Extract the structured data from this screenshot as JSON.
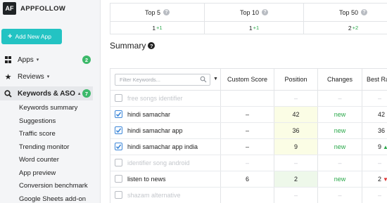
{
  "brand": {
    "logo": "AF",
    "name": "APPFOLLOW"
  },
  "add_button": {
    "label": "Add New App"
  },
  "nav": {
    "apps": {
      "label": "Apps",
      "badge": "2"
    },
    "reviews": {
      "label": "Reviews"
    },
    "keywords": {
      "label": "Keywords & ASO",
      "badge": "7"
    },
    "sub_items": [
      "Keywords summary",
      "Suggestions",
      "Traffic score",
      "Trending monitor",
      "Word counter",
      "App preview",
      "Conversion benchmark",
      "Google Sheets add-on"
    ]
  },
  "top_stats": [
    {
      "label": "Top 5",
      "value": "1",
      "delta": "+1"
    },
    {
      "label": "Top 10",
      "value": "1",
      "delta": "+1"
    },
    {
      "label": "Top 50",
      "value": "2",
      "delta": "+2"
    }
  ],
  "summary": {
    "title": "Summary"
  },
  "table": {
    "filter_placeholder": "Filter Keywords...",
    "columns": {
      "custom_score": "Custom Score",
      "position": "Position",
      "changes": "Changes",
      "best_rank": "Best Ra"
    },
    "rows": [
      {
        "keyword": "free songs identifier",
        "checked": false,
        "muted": true,
        "custom": "",
        "position": "–",
        "change": "–",
        "best": "–",
        "best_arrow": ""
      },
      {
        "keyword": "hindi samachar",
        "checked": true,
        "muted": false,
        "custom": "–",
        "position": "42",
        "change": "new",
        "best": "42",
        "best_arrow": "up"
      },
      {
        "keyword": "hindi samachar app",
        "checked": true,
        "muted": false,
        "custom": "–",
        "position": "36",
        "change": "new",
        "best": "36",
        "best_arrow": "up"
      },
      {
        "keyword": "hindi samachar app india",
        "checked": true,
        "muted": false,
        "custom": "–",
        "position": "9",
        "change": "new",
        "best": "9",
        "best_arrow": "up"
      },
      {
        "keyword": "identifier song android",
        "checked": false,
        "muted": true,
        "custom": "–",
        "position": "–",
        "change": "–",
        "best": "–",
        "best_arrow": ""
      },
      {
        "keyword": "listen to news",
        "checked": false,
        "muted": false,
        "custom": "6",
        "position": "2",
        "change": "new",
        "best": "2",
        "best_arrow": "down"
      },
      {
        "keyword": "shazam alternative",
        "checked": false,
        "muted": true,
        "custom": "",
        "position": "–",
        "change": "–",
        "best": "–",
        "best_arrow": ""
      }
    ]
  },
  "colors": {
    "accent": "#23c3c3",
    "badge": "#3cb96a",
    "positive": "#2aa84a",
    "checkbox": "#3b86d8"
  }
}
